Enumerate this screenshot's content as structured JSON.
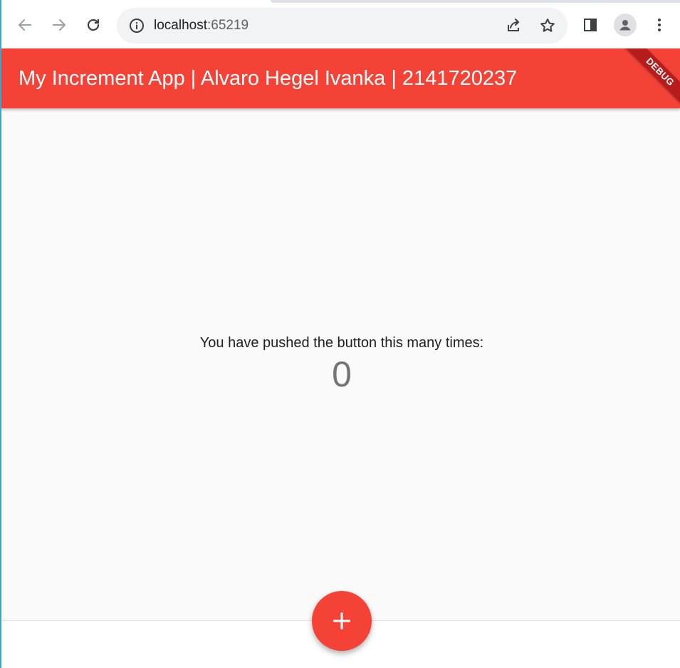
{
  "browser": {
    "url_host": "localhost",
    "url_port": ":65219",
    "icons": {
      "back": "arrow-left-icon",
      "forward": "arrow-right-icon",
      "reload": "reload-icon",
      "info": "info-icon",
      "share": "share-icon",
      "bookmark": "star-icon",
      "side_panel": "side-panel-icon",
      "profile": "profile-icon",
      "menu": "more-vertical-icon"
    }
  },
  "app": {
    "title": "My Increment App | Alvaro Hegel Ivanka | 2141720237",
    "debug_banner": "DEBUG",
    "prompt": "You have pushed the button this many times:",
    "counter": "0",
    "fab_icon": "plus-icon",
    "colors": {
      "primary": "#f44336",
      "banner": "#b71c1c",
      "background": "#fafafa"
    }
  }
}
